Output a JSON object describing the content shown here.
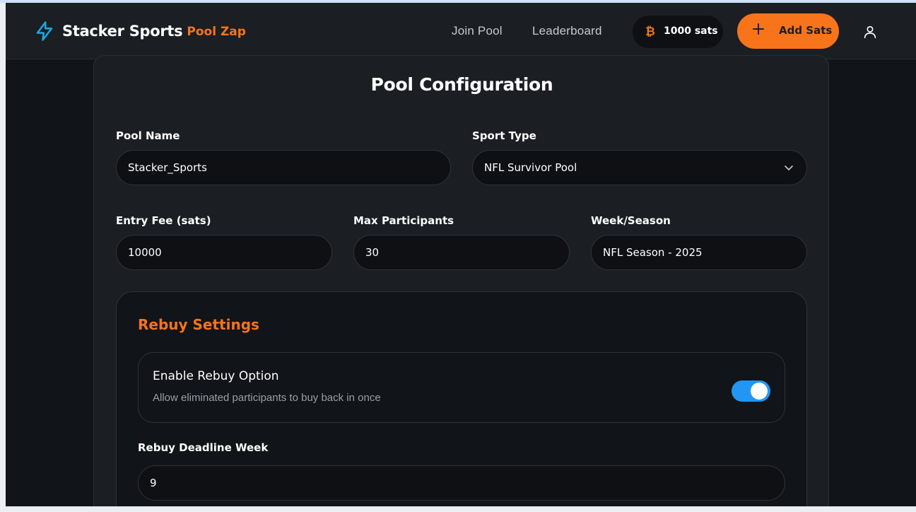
{
  "header": {
    "brand_name": "Stacker Sports",
    "brand_sub": "Pool Zap",
    "nav": [
      {
        "label": "Join Pool"
      },
      {
        "label": "Leaderboard"
      }
    ],
    "sats_balance": "1000 sats",
    "add_sats_label": "Add Sats",
    "accent_color": "#f7741a"
  },
  "config": {
    "title": "Pool Configuration",
    "pool_name": {
      "label": "Pool Name",
      "value": "Stacker_Sports"
    },
    "sport_type": {
      "label": "Sport Type",
      "value": "NFL Survivor Pool"
    },
    "entry_fee": {
      "label": "Entry Fee (sats)",
      "value": "10000"
    },
    "max_participants": {
      "label": "Max Participants",
      "value": "30"
    },
    "week_season": {
      "label": "Week/Season",
      "value": "NFL Season - 2025"
    }
  },
  "rebuy": {
    "title": "Rebuy Settings",
    "option_title": "Enable Rebuy Option",
    "option_desc": "Allow eliminated participants to buy back in once",
    "enabled": true,
    "deadline_label": "Rebuy Deadline Week",
    "deadline_value": "9"
  }
}
